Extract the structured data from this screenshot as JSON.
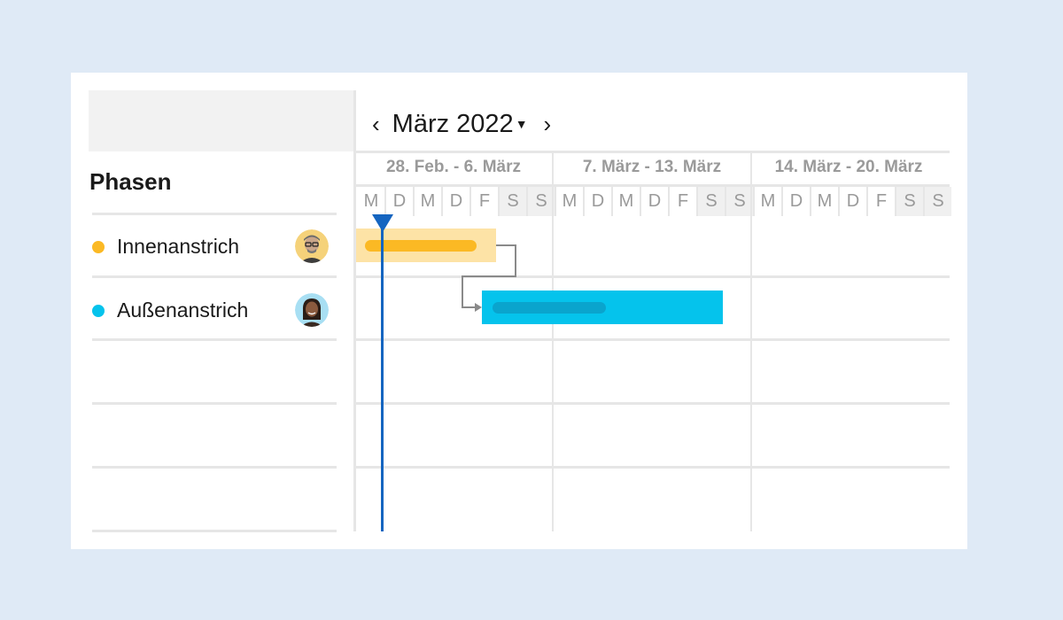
{
  "calendar": {
    "month_label": "März 2022",
    "prev_icon": "chevron-left-icon",
    "next_icon": "chevron-right-icon",
    "caret_icon": "caret-down-icon"
  },
  "phases": {
    "title": "Phasen",
    "items": [
      {
        "name": "Innenanstrich",
        "color": "#fbb924",
        "avatar": "avatar-man-glasses"
      },
      {
        "name": "Außenanstrich",
        "color": "#05c3ec",
        "avatar": "avatar-woman"
      }
    ]
  },
  "weeks": [
    {
      "label": "28. Feb. - 6. März",
      "days": [
        "M",
        "D",
        "M",
        "D",
        "F",
        "S",
        "S"
      ]
    },
    {
      "label": "7. März - 13. März",
      "days": [
        "M",
        "D",
        "M",
        "D",
        "F",
        "S",
        "S"
      ]
    },
    {
      "label": "14. März - 20. März",
      "days": [
        "M",
        "D",
        "M",
        "D",
        "F",
        "S",
        "S"
      ]
    }
  ],
  "colors": {
    "today_line": "#1565c0",
    "bar_yellow": "#fbb924",
    "bar_yellow_bg": "#fde3a6",
    "bar_cyan": "#05c3ec",
    "bar_cyan_progress": "#0aa4cd"
  }
}
